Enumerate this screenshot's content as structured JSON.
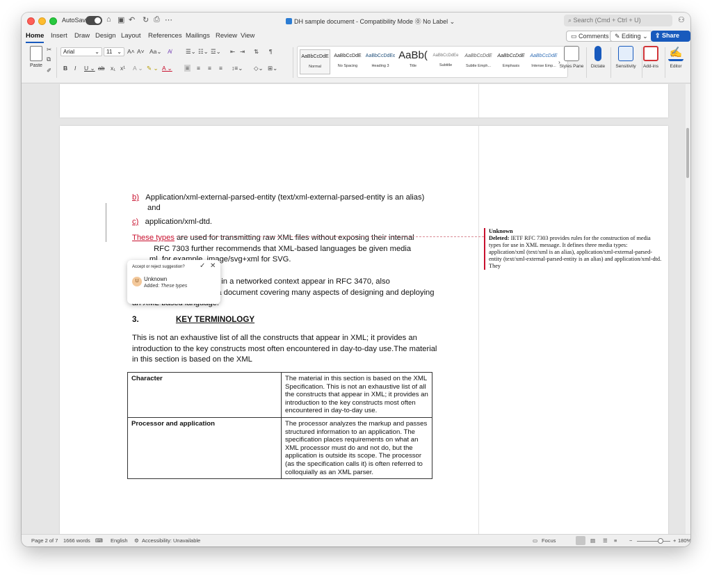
{
  "titlebar": {
    "autosave_label": "AutoSave",
    "doc_title": "DH sample document  -  Compatibility Mode  ⓪ No Label ⌄",
    "search_placeholder": "Search (Cmd + Ctrl + U)"
  },
  "tabs": [
    "Home",
    "Insert",
    "Draw",
    "Design",
    "Layout",
    "References",
    "Mailings",
    "Review",
    "View"
  ],
  "tab_actions": {
    "comments": "Comments",
    "editing": "Editing",
    "share": "Share"
  },
  "ribbon": {
    "paste_label": "Paste",
    "font_name": "Arial",
    "font_size": "11",
    "styles": [
      {
        "sample": "AaBbCcDdE",
        "name": "Normal"
      },
      {
        "sample": "AaBbCcDdE",
        "name": "No Spacing"
      },
      {
        "sample": "AaBbCcDdEε",
        "name": "Heading 3"
      },
      {
        "sample": "AaBb(",
        "name": "Title"
      },
      {
        "sample": "AaBbCcDdEe",
        "name": "Subtitle"
      },
      {
        "sample": "AaBbCcDdE",
        "name": "Subtle Emph..."
      },
      {
        "sample": "AaBbCcDdE",
        "name": "Emphasis"
      },
      {
        "sample": "AaBbCcDdE",
        "name": "Intense Emp..."
      }
    ],
    "tools": {
      "styles_pane": "Styles Pane",
      "dictate": "Dictate",
      "sensitivity": "Sensitivity",
      "addins": "Add-ins",
      "editor": "Editor"
    }
  },
  "document": {
    "item_b_marker": "b)",
    "item_b_text": "Application/xml-external-parsed-entity (text/xml-external-parsed-entity is an alias)",
    "item_b_cont": "and",
    "item_c_marker": "c)",
    "item_c_text": "application/xml-dtd.",
    "para1_inserted": "These types",
    "para1_rest": " are used for transmitting raw XML files without exposing their internal",
    "para1_line2": "          RFC 7303 further recommends that XML-based languages be given media",
    "para1_line3": "        ml, for example, image/svg+xml for SVG.",
    "para2_line1": "            or the use of XML in a networked context appear in RFC 3470, also",
    "para2_line2": "known as IETF BCP 70, a document covering many aspects of designing and deploying",
    "para2_line3": "an XML-based language.",
    "heading_number": "3.",
    "heading_title": "KEY TERMINOLOGY",
    "para3_line1": "This is not an exhaustive list of all the constructs that appear in XML; it provides an",
    "para3_line2": "introduction to the key constructs most often encountered in day-to-day use.The material",
    "para3_line3": "in this section is based on the XML",
    "table": [
      {
        "term": "Character",
        "desc": "The material in this section is based on the XML Specification. This is not an exhaustive list of all the constructs that appear in XML; it provides an introduction to the key constructs most often encountered in day-to-day use."
      },
      {
        "term": "Processor and application",
        "desc": "The processor analyzes the markup and passes structured information to an application. The specification places requirements on what an XML processor must do and not do, but the application is outside its scope. The processor (as the specification calls it) is often referred to colloquially as an XML parser."
      }
    ]
  },
  "balloon": {
    "author": "Unknown",
    "deleted_label": "Deleted:",
    "deleted_text": " IETF RFC 7303 provides rules for the construction of media types for use in XML message. It defines three media types: application/xml (text/xml is an alias), application/xml-external-parsed-entity (text/xml-external-parsed-entity is an alias) and application/xml-dtd. They"
  },
  "popup": {
    "question": "Accept or reject suggestion?",
    "avatar_initial": "U",
    "author": "Unknown",
    "added_label": "Added: ",
    "added_text": "These types"
  },
  "statusbar": {
    "page": "Page 2 of 7",
    "words": "1666 words",
    "language": "English",
    "accessibility": "Accessibility: Unavailable",
    "focus": "Focus",
    "zoom": "180%"
  }
}
